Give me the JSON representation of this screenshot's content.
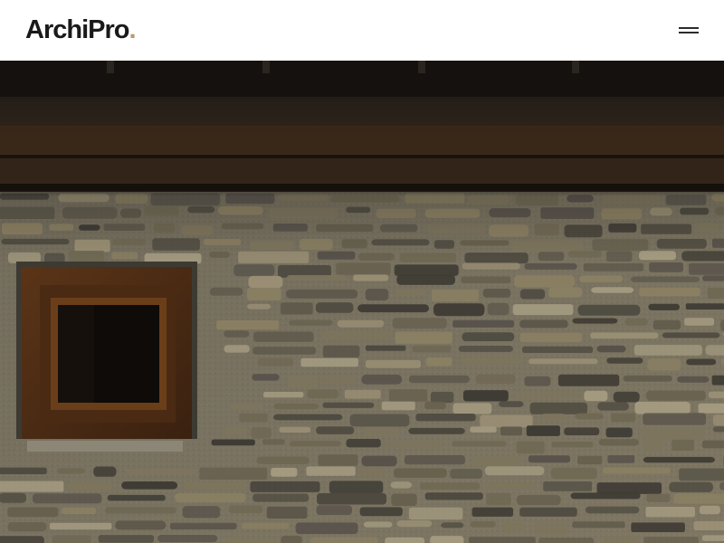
{
  "header": {
    "logo_text": "ArchiPro",
    "logo_dot": ".",
    "logo_accent_color": "#b89a6e",
    "menu_icon": "hamburger-menu-icon"
  },
  "hero": {
    "image_subject": "stone-wall-with-timber-window-photo"
  }
}
